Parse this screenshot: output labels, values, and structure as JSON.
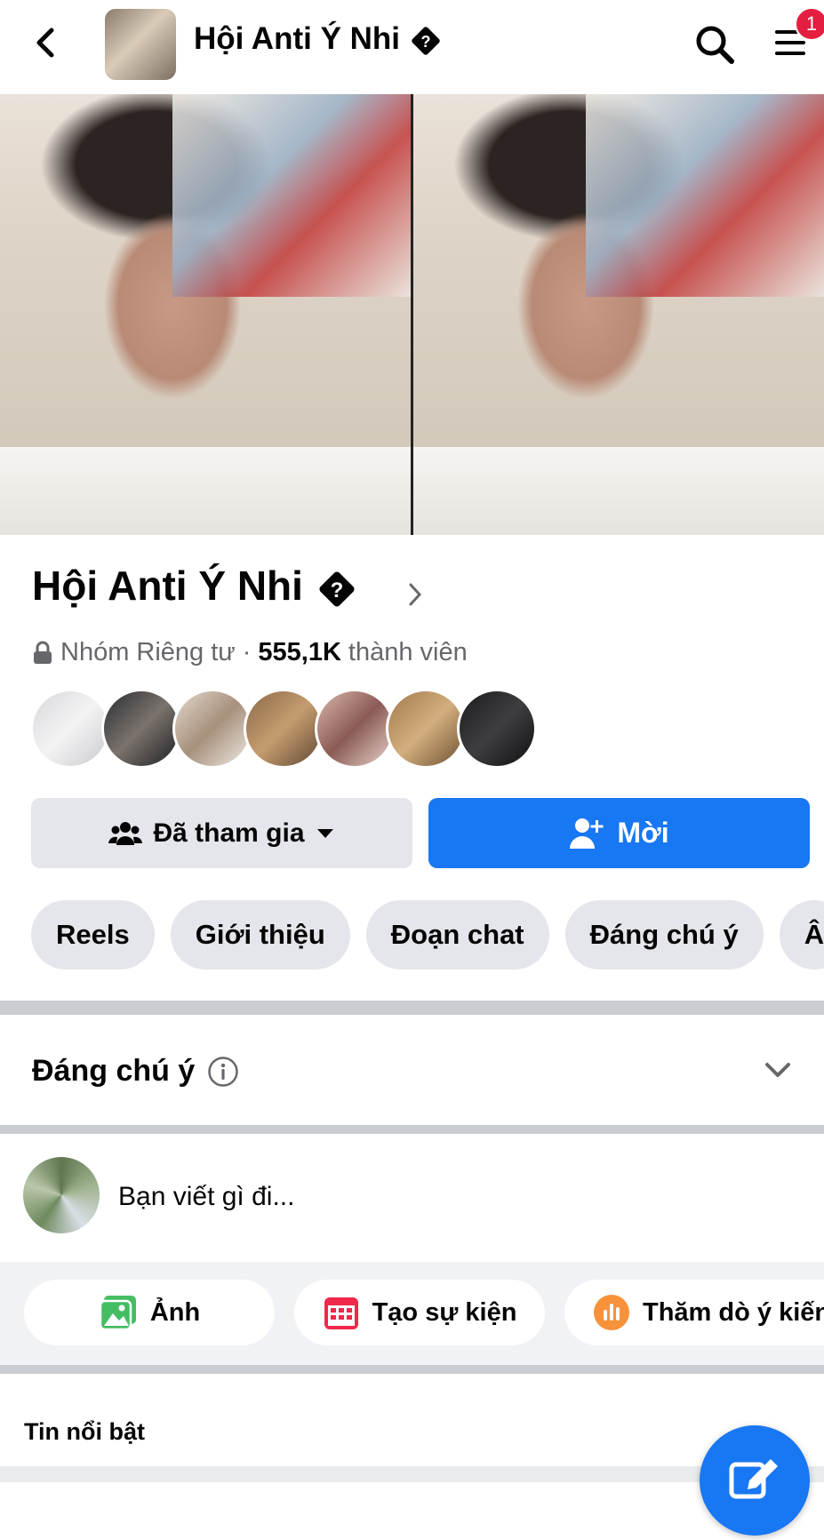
{
  "topbar": {
    "title": "Hội Anti Ý Nhi",
    "menu_badge": "1"
  },
  "group": {
    "title": "Hội Anti Ý Nhi",
    "privacy": "Nhóm Riêng tư",
    "dot": "·",
    "members_count": "555,1K",
    "members_label": "thành viên"
  },
  "buttons": {
    "joined": "Đã tham gia",
    "invite": "Mời"
  },
  "tabs": [
    "Reels",
    "Giới thiệu",
    "Đoạn chat",
    "Đáng chú ý",
    "Â"
  ],
  "featured": {
    "title": "Đáng chú ý"
  },
  "composer": {
    "placeholder": "Bạn viết gì đi..."
  },
  "actions": {
    "photo": "Ảnh",
    "event": "Tạo sự kiện",
    "poll": "Thăm dò ý kiến"
  },
  "section": {
    "title": "Tin nổi bật"
  },
  "colors": {
    "primary": "#1877f2",
    "badge": "#e41e3f",
    "chip": "#e4e6eb",
    "muted": "#65676b"
  }
}
